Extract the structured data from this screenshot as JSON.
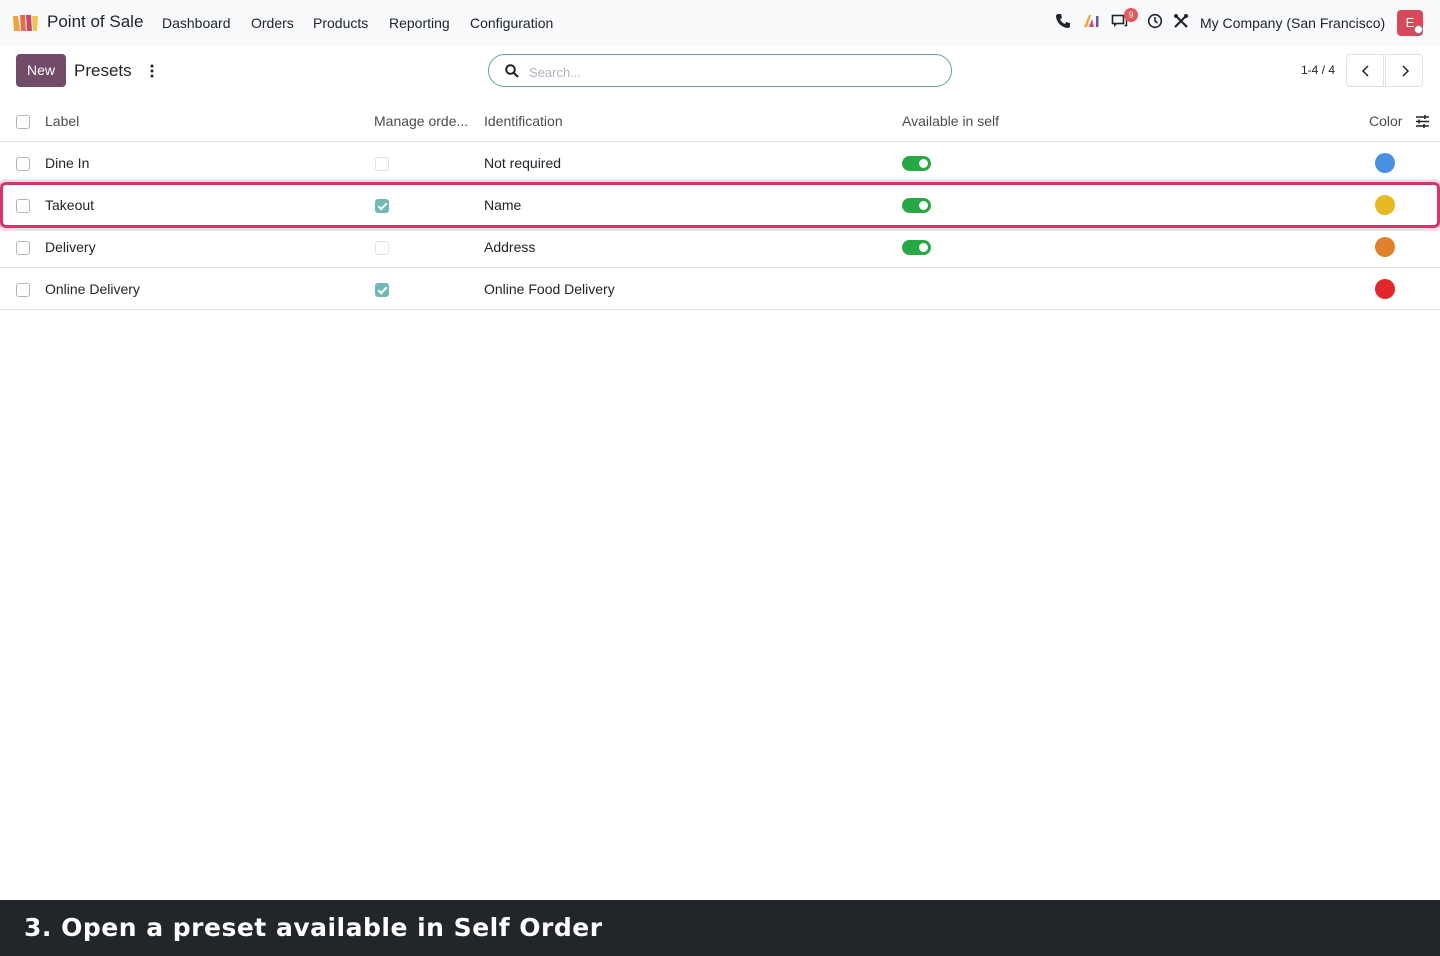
{
  "app": {
    "name": "Point of Sale",
    "menu": [
      "Dashboard",
      "Orders",
      "Products",
      "Reporting",
      "Configuration"
    ],
    "company": "My Company (San Francisco)",
    "avatar_initial": "E",
    "messages_badge": "9"
  },
  "control_panel": {
    "new_label": "New",
    "title": "Presets",
    "search_placeholder": "Search...",
    "pager": "1-4 / 4"
  },
  "table": {
    "columns": [
      "Label",
      "Manage orde...",
      "Identification",
      "Available in self",
      "Color"
    ],
    "rows": [
      {
        "label": "Dine In",
        "manage_orders": false,
        "identification": "Not required",
        "available_in_self": true,
        "color": "#4a90e2"
      },
      {
        "label": "Takeout",
        "manage_orders": true,
        "identification": "Name",
        "available_in_self": true,
        "color": "#e8b923"
      },
      {
        "label": "Delivery",
        "manage_orders": false,
        "identification": "Address",
        "available_in_self": true,
        "color": "#e0822c"
      },
      {
        "label": "Online Delivery",
        "manage_orders": true,
        "identification": "Online Food Delivery",
        "available_in_self": false,
        "color": "#e3262b"
      }
    ]
  },
  "colors": {
    "brand": "#714b67",
    "highlight": "#d8336a",
    "toggle_on": "#28a745"
  },
  "caption": "3. Open a preset available in Self Order"
}
